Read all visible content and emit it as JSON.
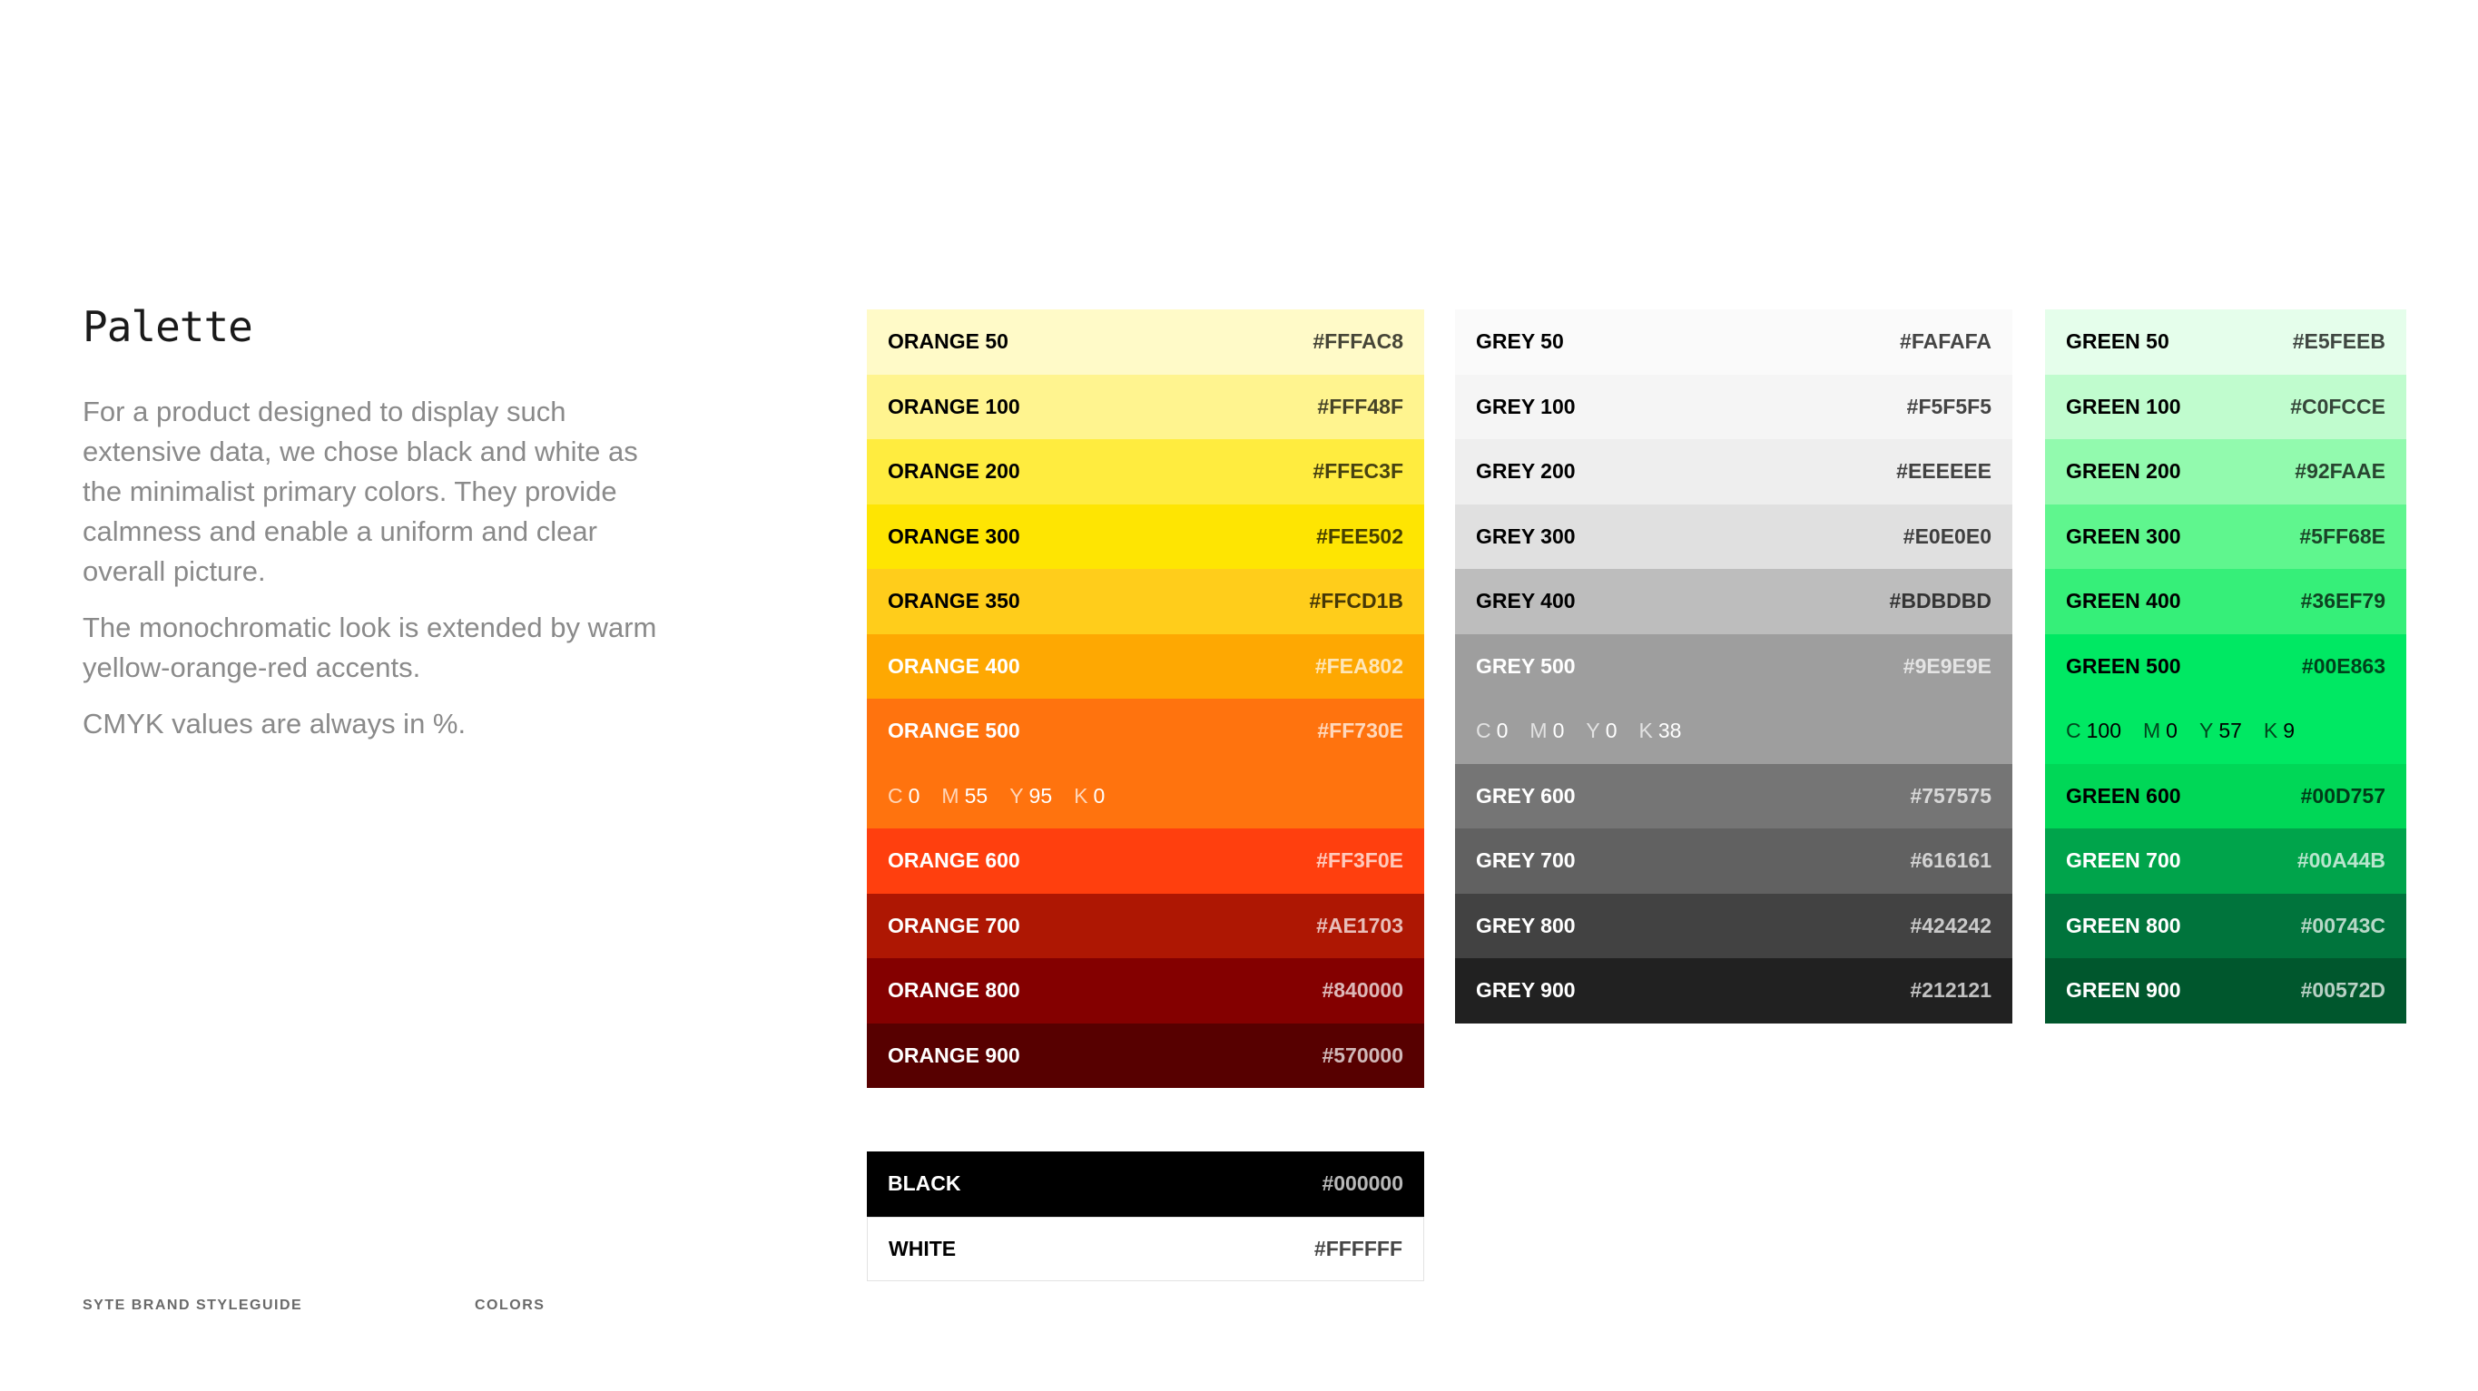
{
  "title": "Palette",
  "intro": {
    "p1": "For a product designed to display such extensive data, we chose black and white as the minimalist primary colors. They provide calmness and enable a uniform and clear overall picture.",
    "p2": "The monochromatic look is extended by warm yellow-orange-red accents.",
    "p3": "CMYK values are always in %."
  },
  "footer": {
    "left": "SYTE BRAND STYLEGUIDE",
    "right": "COLORS"
  },
  "orange": [
    {
      "name": "ORANGE 50",
      "hex": "#FFFAC8",
      "bg": "#FFFAC8",
      "fg": "#000000"
    },
    {
      "name": "ORANGE 100",
      "hex": "#FFF48F",
      "bg": "#FFF48F",
      "fg": "#000000"
    },
    {
      "name": "ORANGE 200",
      "hex": "#FFEC3F",
      "bg": "#FFEC3F",
      "fg": "#000000"
    },
    {
      "name": "ORANGE 300",
      "hex": "#FEE502",
      "bg": "#FEE502",
      "fg": "#000000"
    },
    {
      "name": "ORANGE 350",
      "hex": "#FFCD1B",
      "bg": "#FFCD1B",
      "fg": "#000000"
    },
    {
      "name": "ORANGE 400",
      "hex": "#FEA802",
      "bg": "#FEA802",
      "fg": "#FFFFFF"
    },
    {
      "name": "ORANGE 500",
      "hex": "#FF730E",
      "bg": "#FF730E",
      "fg": "#FFFFFF"
    },
    {
      "cmyk": [
        [
          "C",
          "0"
        ],
        [
          "M",
          "55"
        ],
        [
          "Y",
          "95"
        ],
        [
          "K",
          "0"
        ]
      ],
      "bg": "#FF730E",
      "fg": "#FFFFFF"
    },
    {
      "name": "ORANGE 600",
      "hex": "#FF3F0E",
      "bg": "#FF3F0E",
      "fg": "#FFFFFF"
    },
    {
      "name": "ORANGE 700",
      "hex": "#AE1703",
      "bg": "#AE1703",
      "fg": "#FFFFFF"
    },
    {
      "name": "ORANGE 800",
      "hex": "#840000",
      "bg": "#840000",
      "fg": "#FFFFFF"
    },
    {
      "name": "ORANGE 900",
      "hex": "#570000",
      "bg": "#570000",
      "fg": "#FFFFFF"
    }
  ],
  "grey": [
    {
      "name": "GREY 50",
      "hex": "#FAFAFA",
      "bg": "#FAFAFA",
      "fg": "#000000"
    },
    {
      "name": "GREY 100",
      "hex": "#F5F5F5",
      "bg": "#F5F5F5",
      "fg": "#000000"
    },
    {
      "name": "GREY 200",
      "hex": "#EEEEEE",
      "bg": "#EEEEEE",
      "fg": "#000000"
    },
    {
      "name": "GREY 300",
      "hex": "#E0E0E0",
      "bg": "#E0E0E0",
      "fg": "#000000"
    },
    {
      "name": "GREY 400",
      "hex": "#BDBDBD",
      "bg": "#BDBDBD",
      "fg": "#000000"
    },
    {
      "name": "GREY 500",
      "hex": "#9E9E9E",
      "bg": "#9E9E9E",
      "fg": "#FFFFFF"
    },
    {
      "cmyk": [
        [
          "C",
          "0"
        ],
        [
          "M",
          "0"
        ],
        [
          "Y",
          "0"
        ],
        [
          "K",
          "38"
        ]
      ],
      "bg": "#9E9E9E",
      "fg": "#FFFFFF"
    },
    {
      "name": "GREY 600",
      "hex": "#757575",
      "bg": "#757575",
      "fg": "#FFFFFF"
    },
    {
      "name": "GREY 700",
      "hex": "#616161",
      "bg": "#616161",
      "fg": "#FFFFFF"
    },
    {
      "name": "GREY 800",
      "hex": "#424242",
      "bg": "#424242",
      "fg": "#FFFFFF"
    },
    {
      "name": "GREY 900",
      "hex": "#212121",
      "bg": "#212121",
      "fg": "#FFFFFF"
    }
  ],
  "green": [
    {
      "name": "GREEN 50",
      "hex": "#E5FEEB",
      "bg": "#E5FEEB",
      "fg": "#000000"
    },
    {
      "name": "GREEN 100",
      "hex": "#C0FCCE",
      "bg": "#C0FCCE",
      "fg": "#000000"
    },
    {
      "name": "GREEN 200",
      "hex": "#92FAAE",
      "bg": "#92FAAE",
      "fg": "#000000"
    },
    {
      "name": "GREEN 300",
      "hex": "#5FF68E",
      "bg": "#5FF68E",
      "fg": "#000000"
    },
    {
      "name": "GREEN 400",
      "hex": "#36EF79",
      "bg": "#36EF79",
      "fg": "#000000"
    },
    {
      "name": "GREEN 500",
      "hex": "#00E863",
      "bg": "#00E863",
      "fg": "#000000"
    },
    {
      "cmyk": [
        [
          "C",
          "100"
        ],
        [
          "M",
          "0"
        ],
        [
          "Y",
          "57"
        ],
        [
          "K",
          "9"
        ]
      ],
      "bg": "#00E863",
      "fg": "#000000"
    },
    {
      "name": "GREEN 600",
      "hex": "#00D757",
      "bg": "#00D757",
      "fg": "#000000"
    },
    {
      "name": "GREEN 700",
      "hex": "#00A44B",
      "bg": "#00A44B",
      "fg": "#FFFFFF"
    },
    {
      "name": "GREEN 800",
      "hex": "#00743C",
      "bg": "#00743C",
      "fg": "#FFFFFF"
    },
    {
      "name": "GREEN 900",
      "hex": "#00572D",
      "bg": "#00572D",
      "fg": "#FFFFFF"
    }
  ],
  "bw": [
    {
      "name": "BLACK",
      "hex": "#000000",
      "bg": "#000000",
      "fg": "#FFFFFF"
    },
    {
      "name": "WHITE",
      "hex": "#FFFFFF",
      "bg": "#FFFFFF",
      "fg": "#000000"
    }
  ]
}
